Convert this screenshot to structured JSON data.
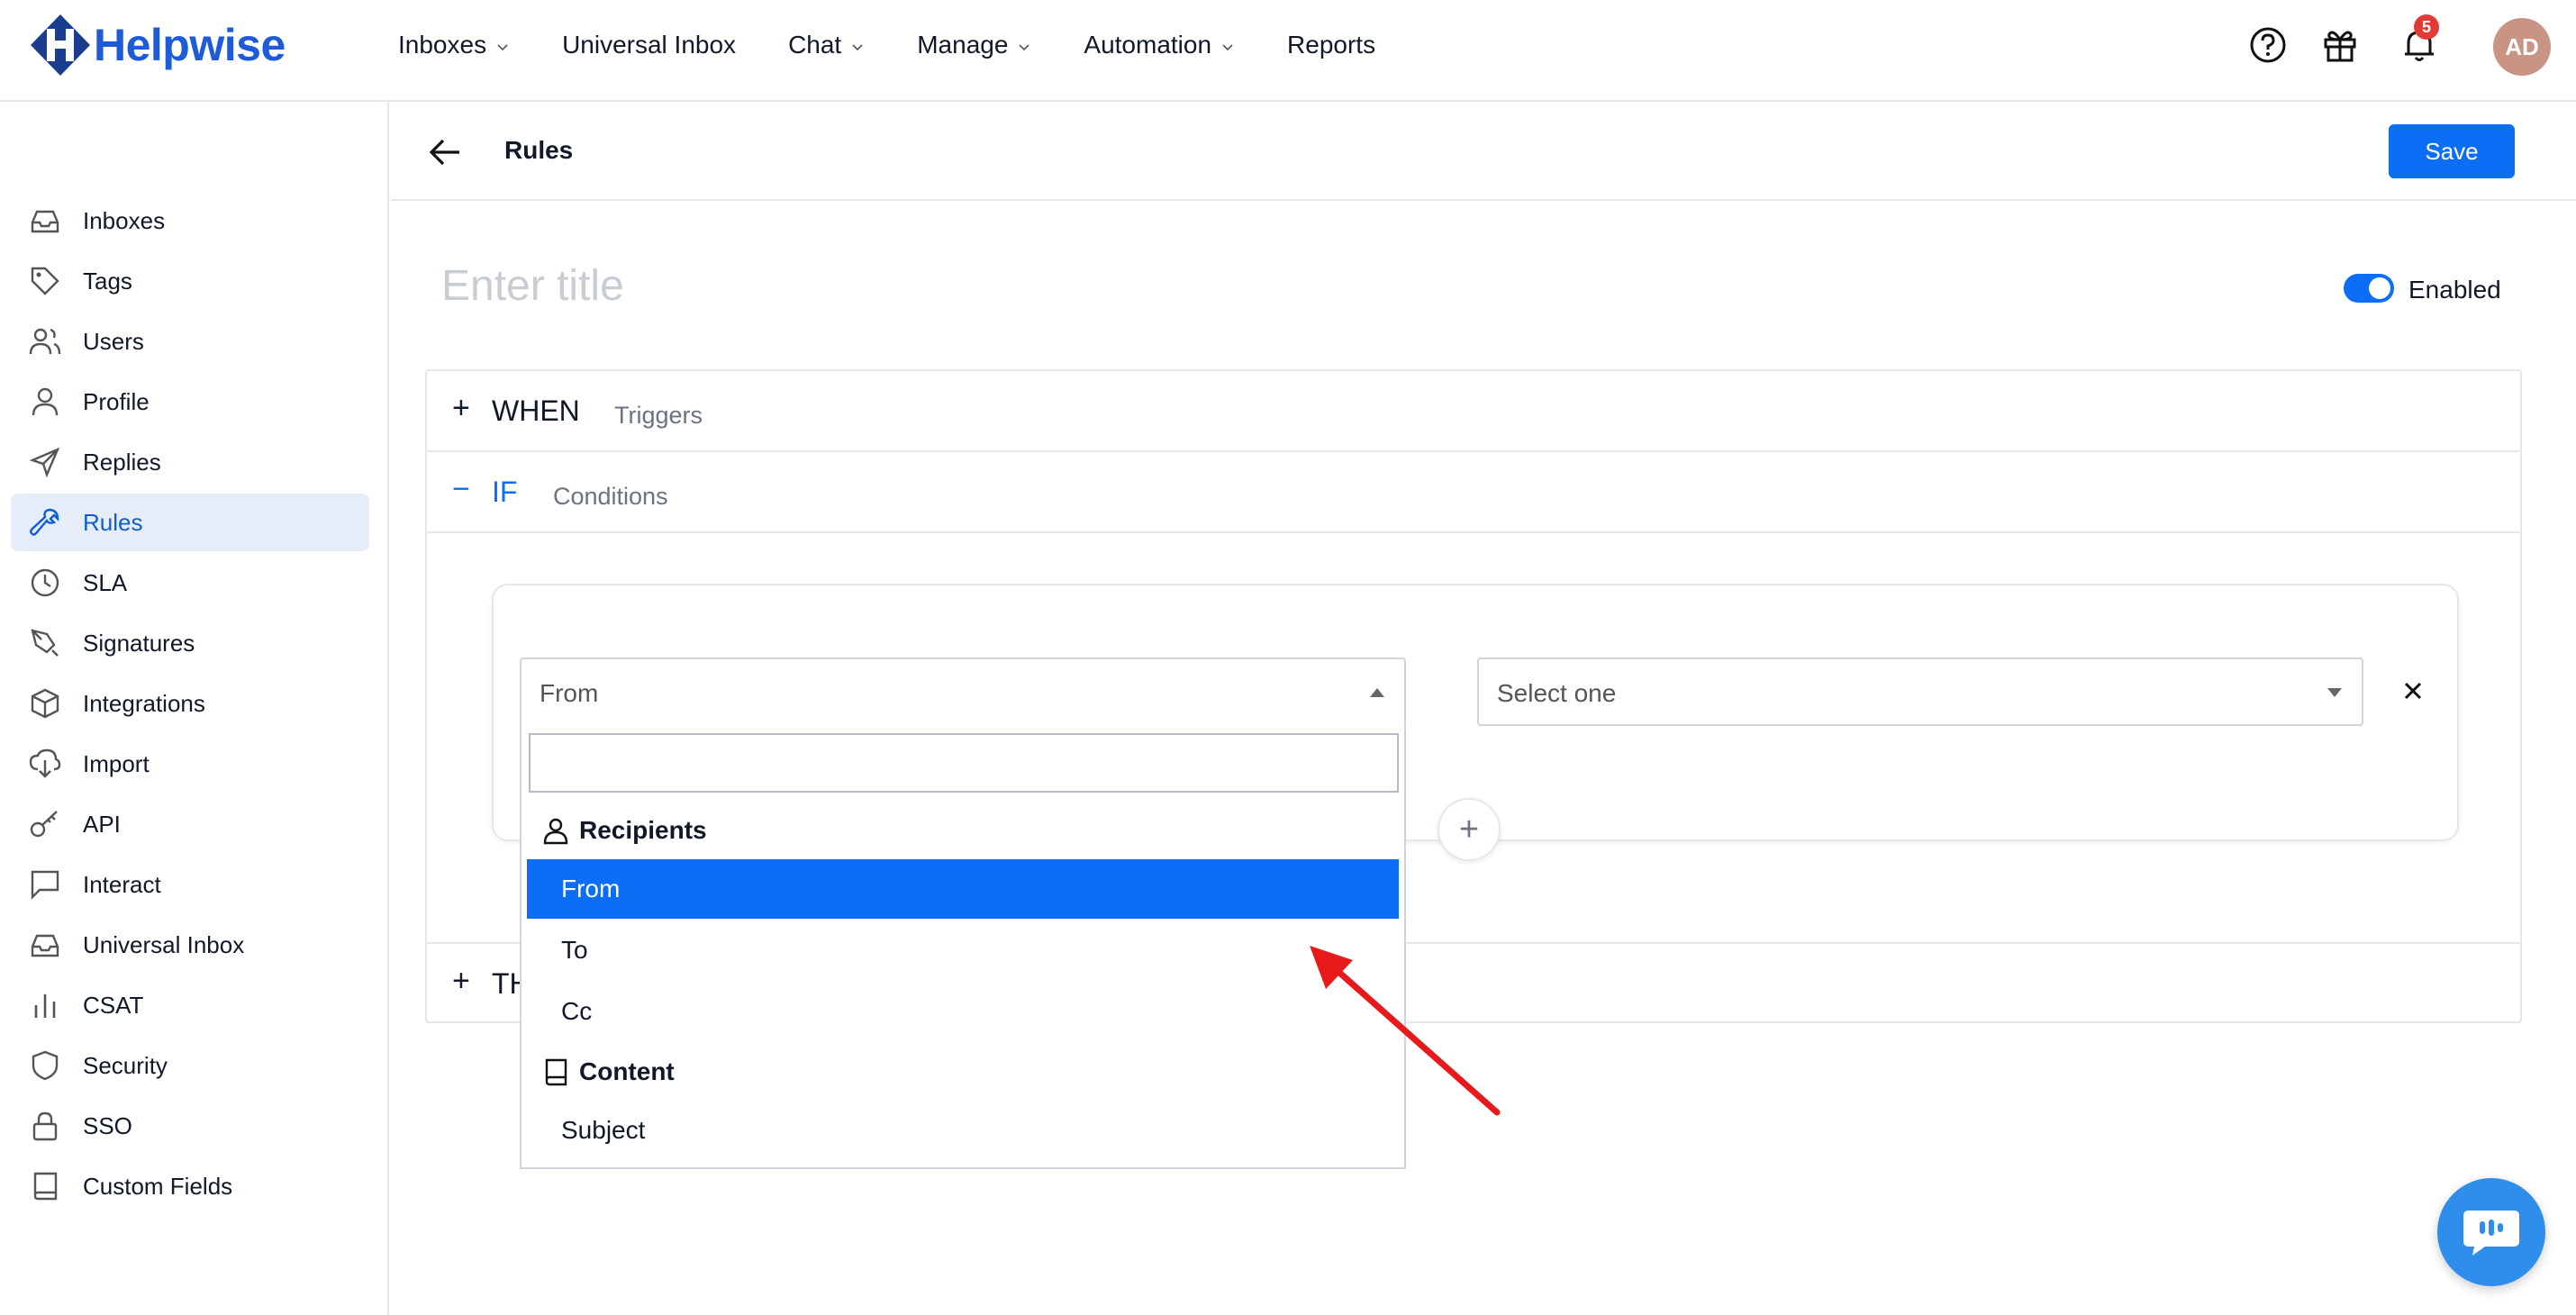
{
  "brand": {
    "name": "Helpwise",
    "color": "#1f5bd8"
  },
  "topnav": {
    "items": [
      {
        "label": "Inboxes",
        "has_dropdown": true
      },
      {
        "label": "Universal Inbox",
        "has_dropdown": false
      },
      {
        "label": "Chat",
        "has_dropdown": true
      },
      {
        "label": "Manage",
        "has_dropdown": true
      },
      {
        "label": "Automation",
        "has_dropdown": true
      },
      {
        "label": "Reports",
        "has_dropdown": false
      }
    ],
    "icons": [
      "help-icon",
      "gift-icon",
      "bell-icon"
    ],
    "notification_count": "5",
    "avatar_initials": "AD"
  },
  "sidebar": {
    "items": [
      {
        "label": "Inboxes",
        "icon": "inbox-icon",
        "active": false
      },
      {
        "label": "Tags",
        "icon": "tag-icon",
        "active": false
      },
      {
        "label": "Users",
        "icon": "users-icon",
        "active": false
      },
      {
        "label": "Profile",
        "icon": "user-icon",
        "active": false
      },
      {
        "label": "Replies",
        "icon": "send-icon",
        "active": false
      },
      {
        "label": "Rules",
        "icon": "wrench-icon",
        "active": true
      },
      {
        "label": "SLA",
        "icon": "clock-icon",
        "active": false
      },
      {
        "label": "Signatures",
        "icon": "pen-icon",
        "active": false
      },
      {
        "label": "Integrations",
        "icon": "box-icon",
        "active": false
      },
      {
        "label": "Import",
        "icon": "import-icon",
        "active": false
      },
      {
        "label": "API",
        "icon": "key-icon",
        "active": false
      },
      {
        "label": "Interact",
        "icon": "chat-icon",
        "active": false
      },
      {
        "label": "Universal Inbox",
        "icon": "inbox-icon",
        "active": false
      },
      {
        "label": "CSAT",
        "icon": "bar-chart-icon",
        "active": false
      },
      {
        "label": "Security",
        "icon": "shield-icon",
        "active": false
      },
      {
        "label": "SSO",
        "icon": "lock-icon",
        "active": false
      },
      {
        "label": "Custom Fields",
        "icon": "book-icon",
        "active": false
      }
    ]
  },
  "header": {
    "title": "Rules",
    "save_label": "Save"
  },
  "rule": {
    "title_placeholder": "Enter title",
    "enabled_label": "Enabled",
    "enabled": true,
    "sections": {
      "when": {
        "sign": "+",
        "title": "WHEN",
        "subtitle": "Triggers"
      },
      "if": {
        "sign": "−",
        "title": "IF",
        "subtitle": "Conditions"
      },
      "then": {
        "sign": "+",
        "title": "TH"
      }
    },
    "condition": {
      "field_value": "From",
      "operator_placeholder": "Select one"
    },
    "add_label": "+"
  },
  "dropdown": {
    "search_value": "",
    "groups": [
      {
        "label": "Recipients",
        "icon": "person-icon"
      },
      {
        "label": "Content",
        "icon": "book-icon"
      }
    ],
    "options": [
      {
        "label": "From",
        "selected": true
      },
      {
        "label": "To",
        "selected": false
      },
      {
        "label": "Cc",
        "selected": false
      },
      {
        "label": "Subject",
        "selected": false
      }
    ]
  },
  "colors": {
    "accent": "#0b6ef5",
    "annotation_arrow": "#e8191b"
  }
}
